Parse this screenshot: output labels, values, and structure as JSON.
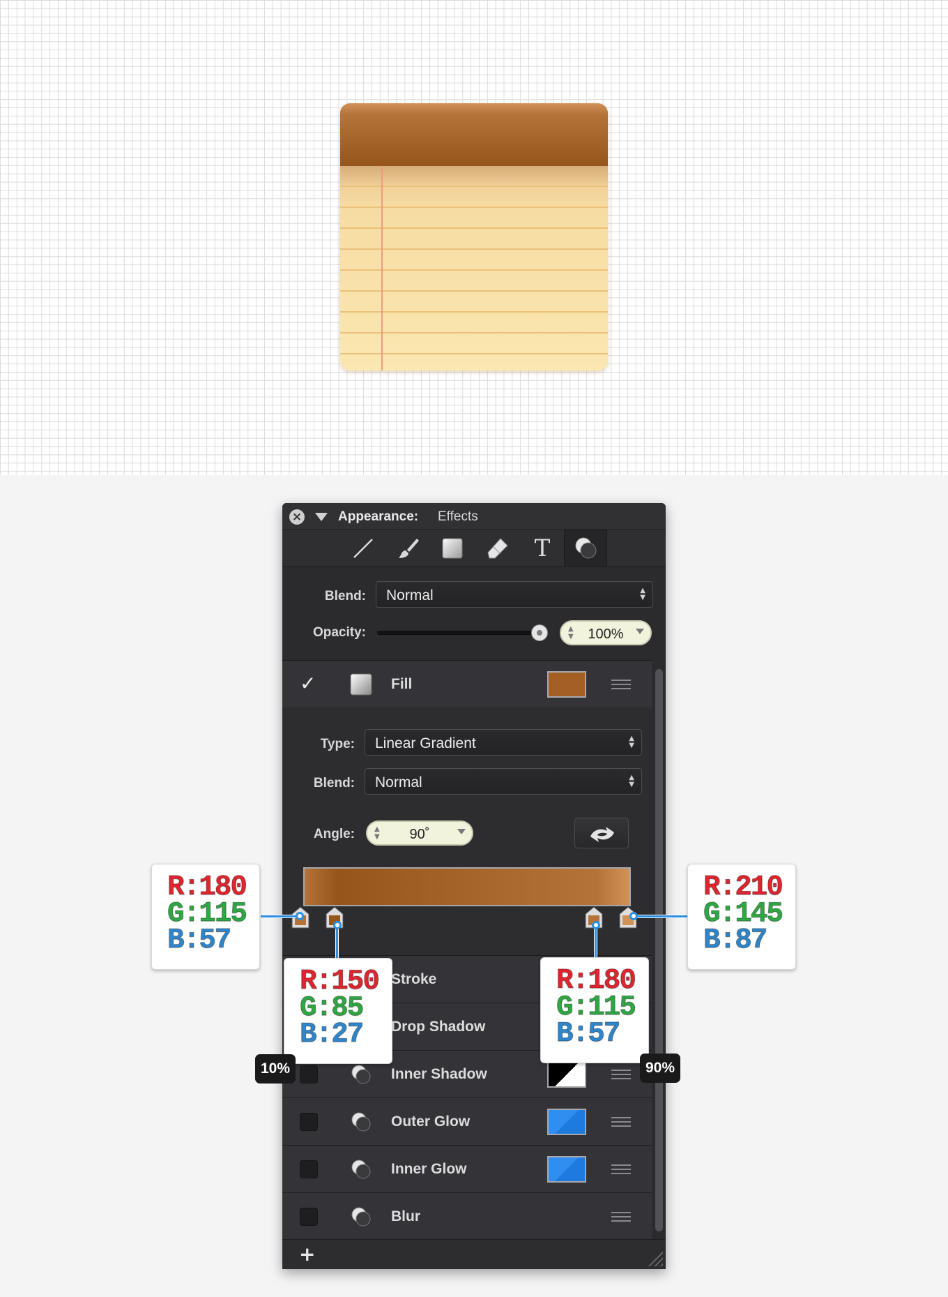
{
  "panel": {
    "title_label": "Appearance:",
    "title_value": "Effects",
    "tools": [
      {
        "name": "line-tool-icon"
      },
      {
        "name": "brush-tool-icon"
      },
      {
        "name": "shape-tool-icon"
      },
      {
        "name": "eraser-tool-icon"
      },
      {
        "name": "text-tool-icon",
        "glyph": "T"
      },
      {
        "name": "effects-tool-icon",
        "active": true
      }
    ],
    "blend_label": "Blend:",
    "blend_value": "Normal",
    "opacity_label": "Opacity:",
    "opacity_value": "100%",
    "opacity_fraction": 1.0
  },
  "fill": {
    "checked": true,
    "label": "Fill",
    "swatch_color": "#a45f25",
    "type_label": "Type:",
    "type_value": "Linear Gradient",
    "blend_label": "Blend:",
    "blend_value": "Normal",
    "angle_label": "Angle:",
    "angle_value": "90˚"
  },
  "gradient_stops": [
    {
      "r": "R:180",
      "g": "G:115",
      "b": "B:57",
      "color": "#b47339"
    },
    {
      "r": "R:150",
      "g": "G:85",
      "b": "B:27",
      "color": "#96551b",
      "location": "10%"
    },
    {
      "r": "R:180",
      "g": "G:115",
      "b": "B:57",
      "color": "#b47339",
      "location": "90%"
    },
    {
      "r": "R:210",
      "g": "G:145",
      "b": "B:87",
      "color": "#d29157"
    }
  ],
  "effects": [
    {
      "label": "Stroke"
    },
    {
      "label": "Drop Shadow"
    },
    {
      "label": "Inner Shadow",
      "swatch": "black"
    },
    {
      "label": "Outer Glow",
      "swatch": "blue"
    },
    {
      "label": "Inner Glow",
      "swatch": "blue"
    },
    {
      "label": "Blur"
    }
  ],
  "add_button_label": "+",
  "colors": {
    "panel_bg": "#2b2b2e",
    "accent_blue": "#2c8fe0",
    "red": "#e0252f",
    "green": "#2ea843",
    "blue": "#2e86cc"
  }
}
